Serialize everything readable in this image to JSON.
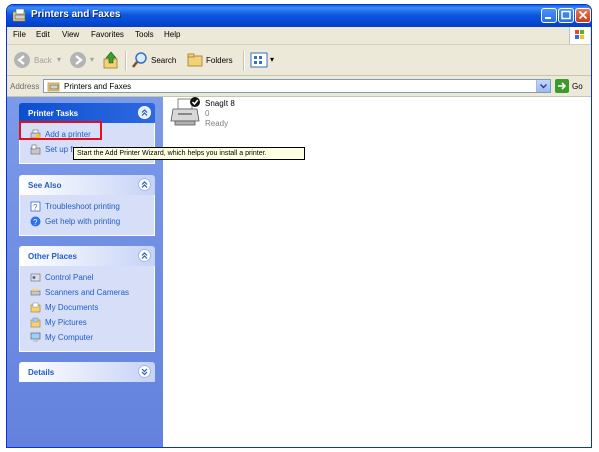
{
  "window": {
    "title": "Printers and Faxes",
    "menu": [
      "File",
      "Edit",
      "View",
      "Favorites",
      "Tools",
      "Help"
    ]
  },
  "toolbar": {
    "back_label": "Back",
    "search_label": "Search",
    "folders_label": "Folders"
  },
  "address": {
    "label": "Address",
    "value": "Printers and Faxes",
    "go_label": "Go"
  },
  "panels": {
    "printer_tasks": {
      "title": "Printer Tasks",
      "items": [
        "Add a printer",
        "Set up faxing"
      ]
    },
    "see_also": {
      "title": "See Also",
      "items": [
        "Troubleshoot printing",
        "Get help with printing"
      ]
    },
    "other_places": {
      "title": "Other Places",
      "items": [
        "Control Panel",
        "Scanners and Cameras",
        "My Documents",
        "My Pictures",
        "My Computer"
      ]
    },
    "details": {
      "title": "Details"
    }
  },
  "tooltip": "Start the Add Printer Wizard, which helps you install a printer.",
  "printer": {
    "name": "SnagIt 8",
    "documents": "0",
    "status": "Ready"
  },
  "colors": {
    "titlebar": "#0b58df",
    "taskpane": "#6382dd",
    "link": "#215dc6",
    "highlight_box": "#e0101e"
  }
}
